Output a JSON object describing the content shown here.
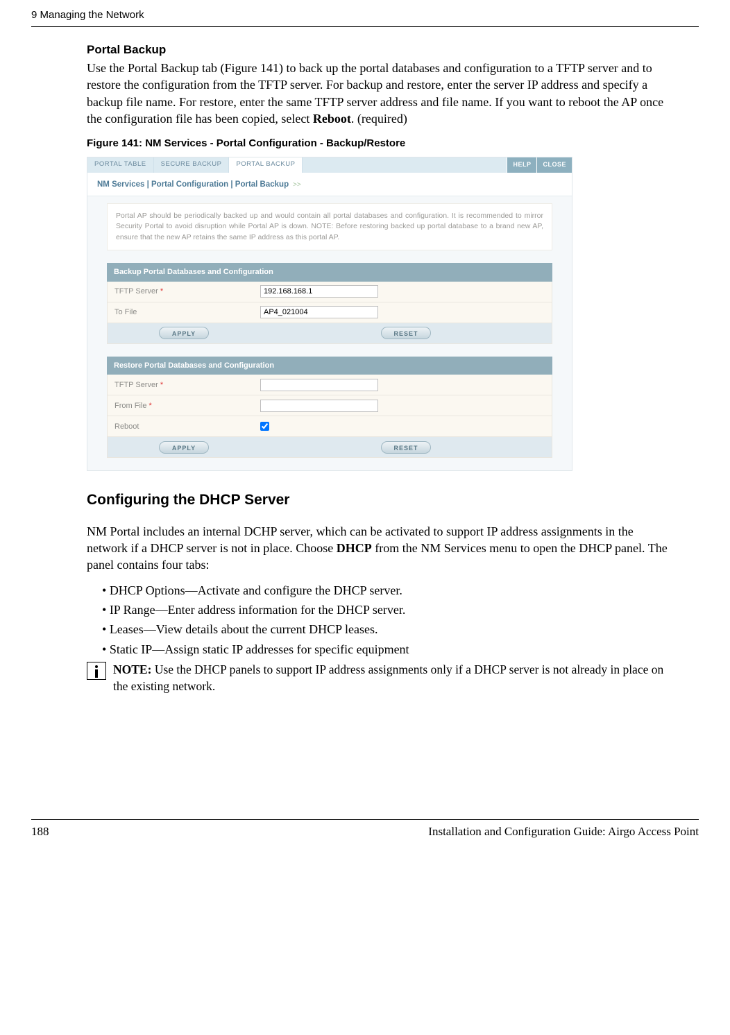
{
  "header": {
    "chapter": "9  Managing the Network"
  },
  "s1": {
    "heading": "Portal Backup",
    "para_parts": {
      "p1": "Use the Portal Backup tab (Figure 141) to back up the portal databases and configuration to a TFTP server and to restore the configuration from the TFTP server. For backup and restore, enter the server IP address and specify a backup file name. For restore, enter the same TFTP server address and file name. If you want to reboot the AP once the configuration file has been copied, select ",
      "bold": "Reboot",
      "p2": ". (required)"
    },
    "fig_caption": "Figure 141:    NM Services - Portal Configuration - Backup/Restore"
  },
  "screenshot": {
    "tabs": {
      "t1": "PORTAL TABLE",
      "t2": "SECURE BACKUP",
      "t3": "PORTAL BACKUP"
    },
    "help": "HELP",
    "close": "CLOSE",
    "breadcrumb": "NM Services | Portal Configuration | Portal Backup",
    "note": "Portal AP should be periodically backed up and would contain all portal databases and configuration. It is recommended to mirror Security Portal to avoid disruption while Portal AP is down. NOTE: Before restoring backed up portal database to a brand new AP, ensure that the new AP retains the same IP address as this portal AP.",
    "backup": {
      "head": "Backup Portal Databases and Configuration",
      "tftp_label": "TFTP Server",
      "tftp_value": "192.168.168.1",
      "tofile_label": "To File",
      "tofile_value": "AP4_021004",
      "apply": "APPLY",
      "reset": "RESET"
    },
    "restore": {
      "head": "Restore Portal Databases and Configuration",
      "tftp_label": "TFTP Server",
      "fromfile_label": "From File",
      "reboot_label": "Reboot",
      "apply": "APPLY",
      "reset": "RESET"
    }
  },
  "s2": {
    "heading": "Configuring the DHCP Server",
    "para_parts": {
      "p1": "NM Portal includes an internal DCHP server, which can be activated to support IP address assignments in the network if a DHCP server is not in place. Choose ",
      "bold": "DHCP",
      "p2": " from the NM Services menu to open the DHCP panel. The panel contains four tabs:"
    },
    "bullets": {
      "b1": "DHCP Options—Activate and configure the DHCP server.",
      "b2": "IP Range—Enter address information for the DHCP server.",
      "b3": "Leases—View details about the current DHCP leases.",
      "b4": "Static IP—Assign static IP addresses for specific equipment"
    },
    "note": {
      "label": "NOTE:",
      "text": " Use the DHCP panels to support IP address assignments only if a DHCP server is not already in place on the existing network."
    }
  },
  "footer": {
    "page": "188",
    "doc": "Installation and Configuration Guide: Airgo Access Point"
  }
}
